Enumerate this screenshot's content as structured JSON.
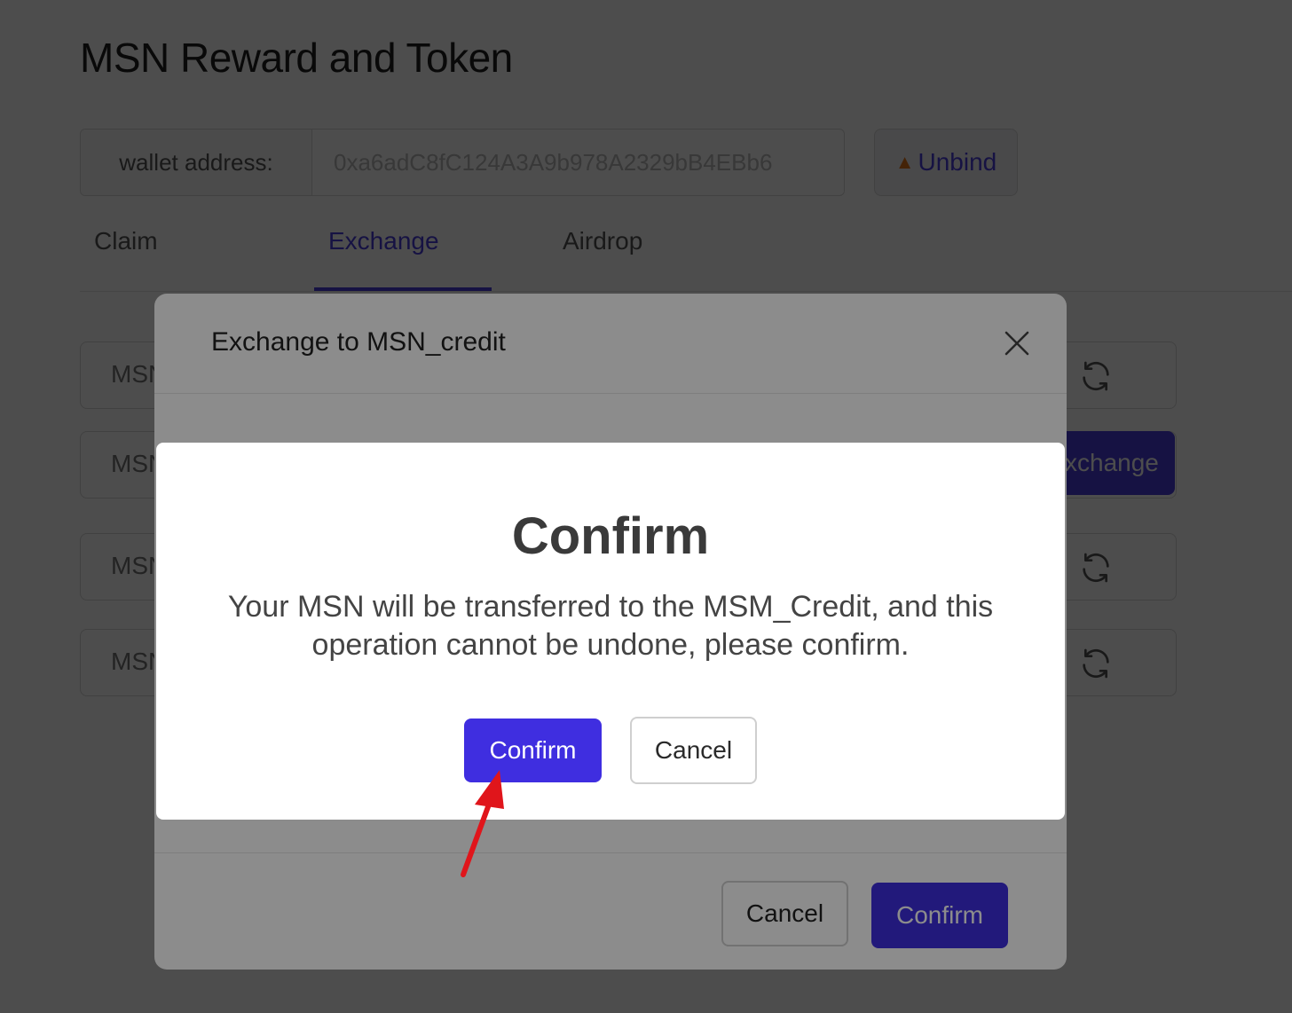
{
  "page": {
    "title": "MSN Reward and Token",
    "wallet": {
      "label": "wallet address:",
      "value": "0xa6adC8fC124A3A9b978A2329bB4EBb6"
    },
    "unbind_label": "Unbind",
    "tabs": [
      {
        "label": "Claim"
      },
      {
        "label": "Exchange"
      },
      {
        "label": "Airdrop"
      }
    ],
    "active_tab": "Exchange",
    "rows": [
      {
        "label": "MSN"
      },
      {
        "label": "MSN"
      },
      {
        "label": "MSN"
      },
      {
        "label": "MSN"
      }
    ],
    "exchange_button_label": "xchange"
  },
  "modal": {
    "title": "Exchange to MSN_credit",
    "cancel_label": "Cancel",
    "confirm_label": "Confirm"
  },
  "confirm_dialog": {
    "title": "Confirm",
    "message": "Your MSN will be transferred to the MSM_Credit, and this operation cannot be undone, please confirm.",
    "confirm_label": "Confirm",
    "cancel_label": "Cancel"
  },
  "colors": {
    "accent": "#3f2ee0",
    "annotation_arrow": "#e0151b"
  }
}
